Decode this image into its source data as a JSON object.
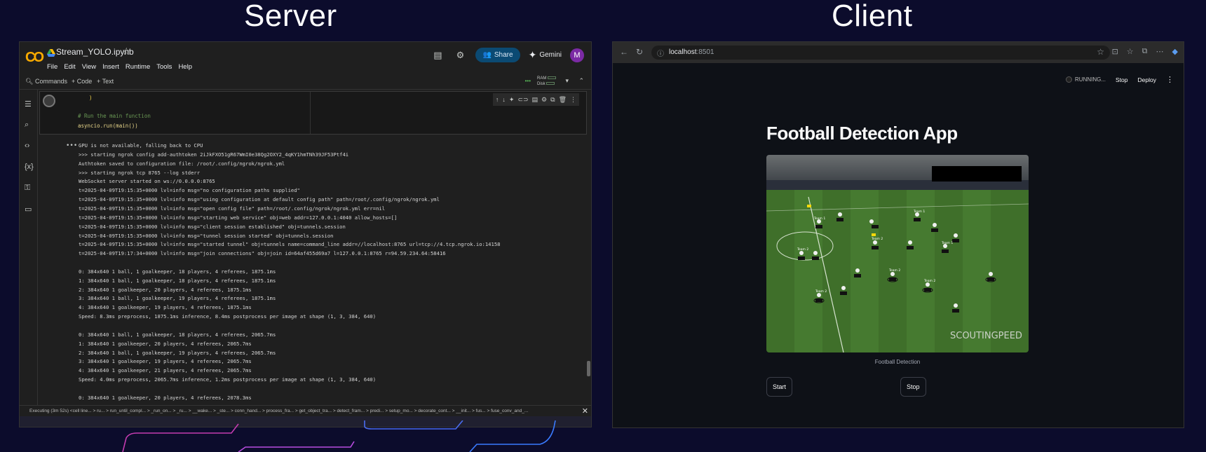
{
  "headings": {
    "server": "Server",
    "client": "Client"
  },
  "colab": {
    "notebook_title": "Stream_YOLO.ipynb",
    "menu": [
      "File",
      "Edit",
      "View",
      "Insert",
      "Runtime",
      "Tools",
      "Help"
    ],
    "share_label": "Share",
    "gemini_label": "Gemini",
    "avatar_letter": "M",
    "commands_label": "Commands",
    "add_code_label": "+ Code",
    "add_text_label": "+ Text",
    "ram_label": "RAM",
    "disk_label": "Disk",
    "cell_lines": [
      ")",
      "",
      "# Run the main function",
      "asyncio.run(main())"
    ],
    "output_lines": [
      "GPU is not available, falling back to CPU",
      ">>> starting ngrok config add-authtoken 2iJkFXO51gR67WmI0e38Qg2OXY2_4qKY1hmTNh39JF53Ptf4i",
      "Authtoken saved to configuration file: /root/.config/ngrok/ngrok.yml",
      ">>> starting ngrok tcp 8765 --log stderr",
      "WebSocket server started on ws://0.0.0.0:8765",
      "t=2025-04-09T19:15:35+0000 lvl=info msg=\"no configuration paths supplied\"",
      "t=2025-04-09T19:15:35+0000 lvl=info msg=\"using configuration at default config path\" path=/root/.config/ngrok/ngrok.yml",
      "t=2025-04-09T19:15:35+0000 lvl=info msg=\"open config file\" path=/root/.config/ngrok/ngrok.yml err=nil",
      "t=2025-04-09T19:15:35+0000 lvl=info msg=\"starting web service\" obj=web addr=127.0.0.1:4040 allow_hosts=[]",
      "t=2025-04-09T19:15:35+0000 lvl=info msg=\"client session established\" obj=tunnels.session",
      "t=2025-04-09T19:15:35+0000 lvl=info msg=\"tunnel session started\" obj=tunnels.session",
      "t=2025-04-09T19:15:35+0000 lvl=info msg=\"started tunnel\" obj=tunnels name=command_line addr=//localhost:8765 url=tcp://4.tcp.ngrok.io:14158",
      "t=2025-04-09T19:17:34+0000 lvl=info msg=\"join connections\" obj=join id=64af455d69a7 l=127.0.0.1:8765 r=94.59.234.64:58416",
      "",
      "0: 384x640 1 ball, 1 goalkeeper, 18 players, 4 referees, 1875.1ms",
      "1: 384x640 1 ball, 1 goalkeeper, 18 players, 4 referees, 1875.1ms",
      "2: 384x640 1 goalkeeper, 20 players, 4 referees, 1875.1ms",
      "3: 384x640 1 ball, 1 goalkeeper, 19 players, 4 referees, 1875.1ms",
      "4: 384x640 1 goalkeeper, 19 players, 4 referees, 1875.1ms",
      "Speed: 8.3ms preprocess, 1875.1ms inference, 8.4ms postprocess per image at shape (1, 3, 384, 640)",
      "",
      "0: 384x640 1 ball, 1 goalkeeper, 18 players, 4 referees, 2065.7ms",
      "1: 384x640 1 goalkeeper, 20 players, 4 referees, 2065.7ms",
      "2: 384x640 1 ball, 1 goalkeeper, 19 players, 4 referees, 2065.7ms",
      "3: 384x640 1 goalkeeper, 19 players, 4 referees, 2065.7ms",
      "4: 384x640 1 goalkeeper, 21 players, 4 referees, 2065.7ms",
      "Speed: 4.0ms preprocess, 2065.7ms inference, 1.2ms postprocess per image at shape (1, 3, 384, 640)",
      "",
      "0: 384x640 1 goalkeeper, 20 players, 4 referees, 2078.3ms"
    ],
    "status_text": "Executing (3m 52s) <cell line...  > ru...  > run_until_compl...  > _run_on...  > _ru...  > __wake...  > _ste...  > conn_hand...  > process_fra...  > get_object_tra...  > detect_fram...  > predi...  > setup_mo...  > decorate_cont...  > __init...  > fus...  > fuse_conv_and_..."
  },
  "browser": {
    "url_host": "localhost",
    "url_port": ":8501",
    "running_label": "RUNNING...",
    "stop_label": "Stop",
    "deploy_label": "Deploy",
    "app_title": "Football Detection App",
    "video_caption": "Football Detection",
    "start_button": "Start",
    "stop_button": "Stop",
    "video_watermark": "SCOUTINGPEED",
    "player_label": "Team 1",
    "player_label_2": "Team 2"
  }
}
